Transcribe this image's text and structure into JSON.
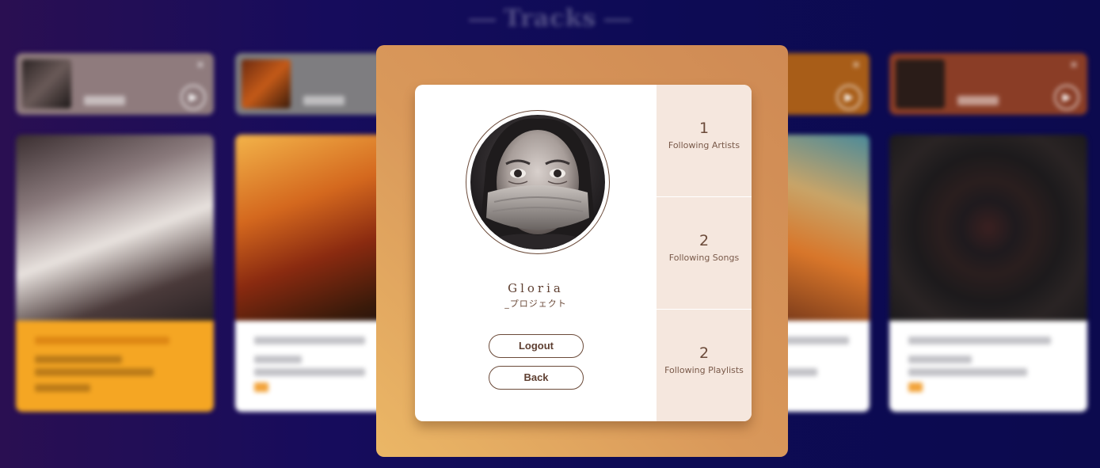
{
  "background": {
    "section_title": "Tracks"
  },
  "profile": {
    "name": "Gloria",
    "handle": "_プロジェクト"
  },
  "actions": {
    "logout_label": "Logout",
    "back_label": "Back"
  },
  "stats": [
    {
      "value": "1",
      "label": "Following Artists"
    },
    {
      "value": "2",
      "label": "Following Songs"
    },
    {
      "value": "2",
      "label": "Following Playlists"
    }
  ],
  "colors": {
    "modal_gradient_start": "#ebb766",
    "modal_gradient_end": "#cf8a54",
    "accent_text": "#5e3f31",
    "stats_panel": "#f5e7de",
    "page_background": "#0d0b55"
  }
}
